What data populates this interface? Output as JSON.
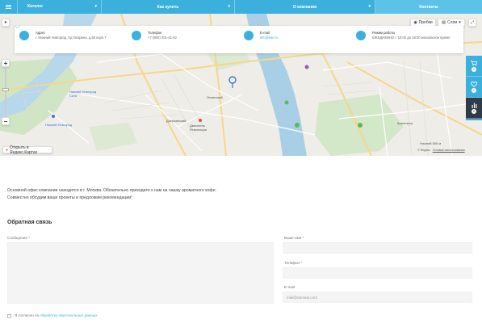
{
  "nav": {
    "items": [
      {
        "label": "Каталог"
      },
      {
        "label": "Как купить"
      },
      {
        "label": "О компании"
      },
      {
        "label": "Контакты"
      }
    ]
  },
  "map": {
    "traffic_label": "Пробки",
    "layers_label": "Слои",
    "open_in_yandex": "Открыть в Яндекс.Картах",
    "scale_text": "Нижний  500 м",
    "copyright": "© Яндекс",
    "terms": "Условия использования",
    "info": {
      "address": {
        "title": "Адрес",
        "value": "г. Нижний Новгород, пр.Гагарина, д.50 корп.7"
      },
      "phone": {
        "title": "Телефон",
        "value": "+7 (800) 201-41-52"
      },
      "email": {
        "title": "E-mail",
        "value": "info@site.ru"
      },
      "hours": {
        "title": "Режим работы",
        "value": "ЕЖЕДНЕВНО с 10:00 до 18:00 московское время"
      }
    },
    "places": [
      "Нижний Новгород Сити",
      "Нижний Новгород",
      "Ленинский",
      "Дзержинский",
      "Двигатель Революции",
      "Кузнечиха"
    ]
  },
  "side_panel": {
    "cart_count": "0",
    "fav_count": "0",
    "compare_count": "0"
  },
  "content": {
    "description_line1": "Основной офис компании находится в г. Москва. Обязательно приходите к нам на чашку ароматного кофе.",
    "description_line2": "Совместно обсудим ваши проекты и предложим рекомендации!"
  },
  "form": {
    "title": "Обратная связь",
    "message_label": "Сообщение",
    "name_label": "Ваше имя",
    "phone_label": "Телефон",
    "email_label": "E-mail",
    "email_placeholder": "mail@domain.com",
    "required_mark": "*",
    "consent_prefix": "Я согласен на",
    "consent_link": "обработку персональных данных"
  },
  "colors": {
    "accent": "#3cb0dc",
    "dark": "#2f3b45"
  }
}
